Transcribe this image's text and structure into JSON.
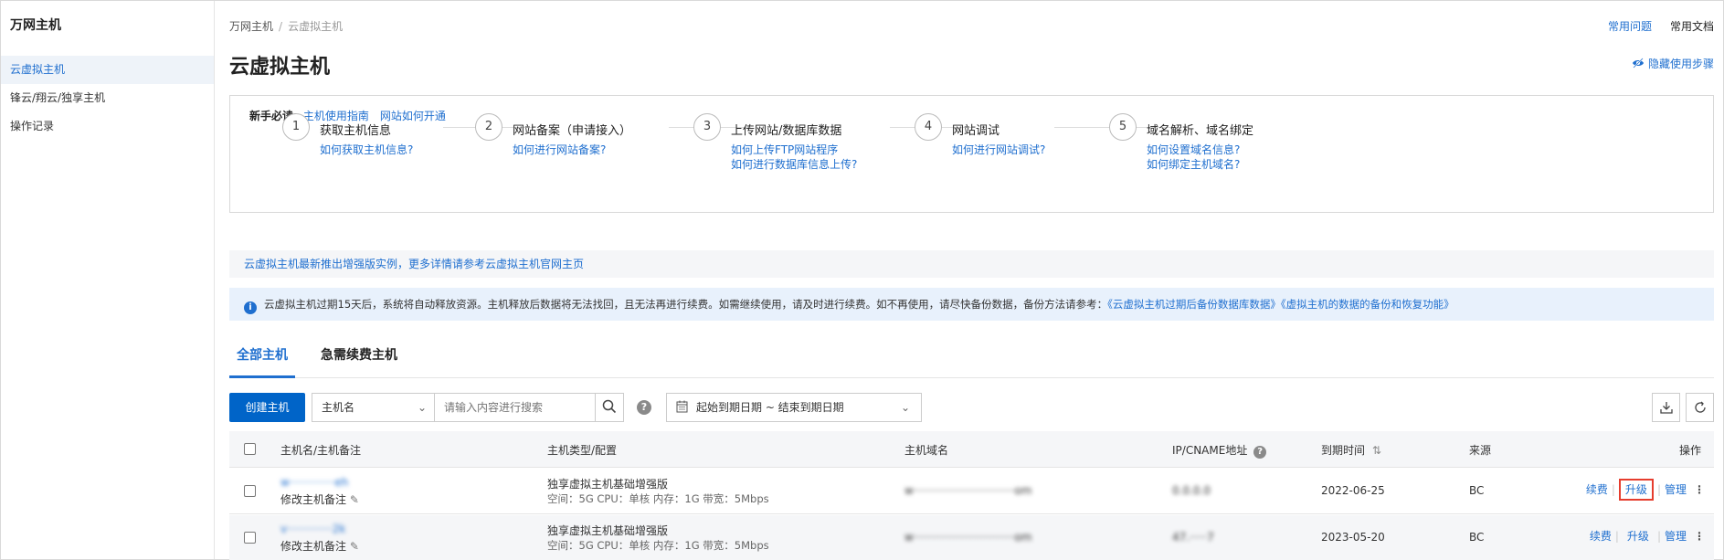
{
  "sidebar": {
    "title": "万网主机",
    "items": [
      {
        "label": "云虚拟主机"
      },
      {
        "label": "锋云/翔云/独享主机"
      },
      {
        "label": "操作记录"
      }
    ]
  },
  "breadcrumb": {
    "root": "万网主机",
    "separator": "/",
    "current": "云虚拟主机"
  },
  "top_links": {
    "faq": "常用问题",
    "docs": "常用文档"
  },
  "page_title": "云虚拟主机",
  "hide_steps": "隐藏使用步骤",
  "guide": {
    "must_read": "新手必读:",
    "links": [
      "主机使用指南",
      "网站如何开通"
    ],
    "steps": [
      {
        "num": "1",
        "title": "获取主机信息",
        "links": [
          "如何获取主机信息?"
        ]
      },
      {
        "num": "2",
        "title": "网站备案（申请接入）",
        "links": [
          "如何进行网站备案?"
        ]
      },
      {
        "num": "3",
        "title": "上传网站/数据库数据",
        "links": [
          "如何上传FTP网站程序",
          "如何进行数据库信息上传?"
        ]
      },
      {
        "num": "4",
        "title": "网站调试",
        "links": [
          "如何进行网站调试?"
        ]
      },
      {
        "num": "5",
        "title": "域名解析、域名绑定",
        "links": [
          "如何设置域名信息?",
          "如何绑定主机域名?"
        ]
      }
    ]
  },
  "banner_enhanced": "云虚拟主机最新推出增强版实例，更多详情请参考云虚拟主机官网主页",
  "banner_notice": {
    "icon": "info-icon",
    "text": "云虚拟主机过期15天后，系统将自动释放资源。主机释放后数据将无法找回，且无法再进行续费。如需继续使用，请及时进行续费。如不再使用，请尽快备份数据，备份方法请参考：",
    "link1": "《云虚拟主机过期后备份数据库数据》",
    "link2": "《虚拟主机的数据的备份和恢复功能》"
  },
  "tabs": [
    {
      "label": "全部主机",
      "active": true
    },
    {
      "label": "急需续费主机",
      "active": false
    }
  ],
  "toolbar": {
    "create_label": "创建主机",
    "filter_field": "主机名",
    "search_placeholder": "请输入内容进行搜索",
    "help": "?",
    "date_range": "起始到期日期 ~ 结束到期日期"
  },
  "table": {
    "headers": {
      "name": "主机名/主机备注",
      "type": "主机类型/配置",
      "domain": "主机域名",
      "ip": "IP/CNAME地址",
      "expire": "到期时间",
      "source": "来源",
      "ops": "操作"
    },
    "rows": [
      {
        "name": "w·············eh",
        "note": "修改主机备注",
        "type": "独享虚拟主机基础增强版",
        "config": "空间：5G CPU：单核 内存：1G 带宽：5Mbps",
        "domain": "w·····························om",
        "ip": "0.0.0.0",
        "expire": "2022-06-25",
        "source": "BC",
        "renew": "续费",
        "upgrade": "升级",
        "manage": "管理"
      },
      {
        "name": "v·············2k",
        "note": "修改主机备注",
        "type": "独享虚拟主机基础增强版",
        "config": "空间：5G CPU：单核 内存：1G 带宽：5Mbps",
        "domain": "w·····························om",
        "ip": "47.·····7",
        "expire": "2023-05-20",
        "source": "BC",
        "renew": "续费",
        "upgrade": "升级",
        "manage": "管理"
      }
    ]
  }
}
